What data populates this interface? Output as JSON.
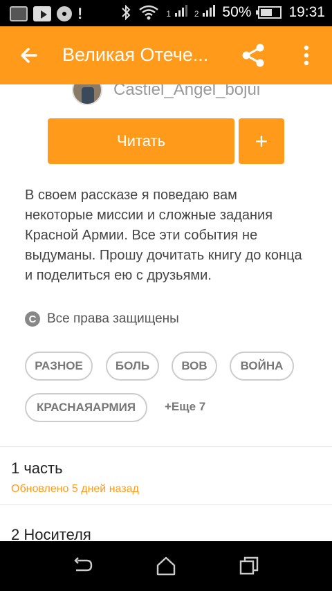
{
  "status_bar": {
    "battery": "50%",
    "time": "19:31",
    "signal_label": "1",
    "signal2_label": "2"
  },
  "app_bar": {
    "title": "Великая Отече..."
  },
  "author": {
    "name": "Castiel_Angel_bojui"
  },
  "actions": {
    "read_label": "Читать",
    "add_label": "+"
  },
  "description": "В своем рассказе я поведаю вам некоторые миссии и сложные задания Красной Армии. Все эти события не выдуманы. Прошу дочитать книгу до конца и поделиться ею с друзьями.",
  "rights": {
    "icon_glyph": "C",
    "text": "Все права защищены"
  },
  "tags": [
    "РАЗНОЕ",
    "БОЛЬ",
    "ВОВ",
    "ВОЙНА",
    "КРАСНАЯАРМИЯ"
  ],
  "more_tags_label": "+Еще 7",
  "chapters": [
    {
      "title": "1 часть",
      "updated": "Обновлено 5 дней назад"
    },
    {
      "title": "2 Носителя",
      "updated": ""
    }
  ],
  "colors": {
    "accent": "#ff9a1a"
  }
}
